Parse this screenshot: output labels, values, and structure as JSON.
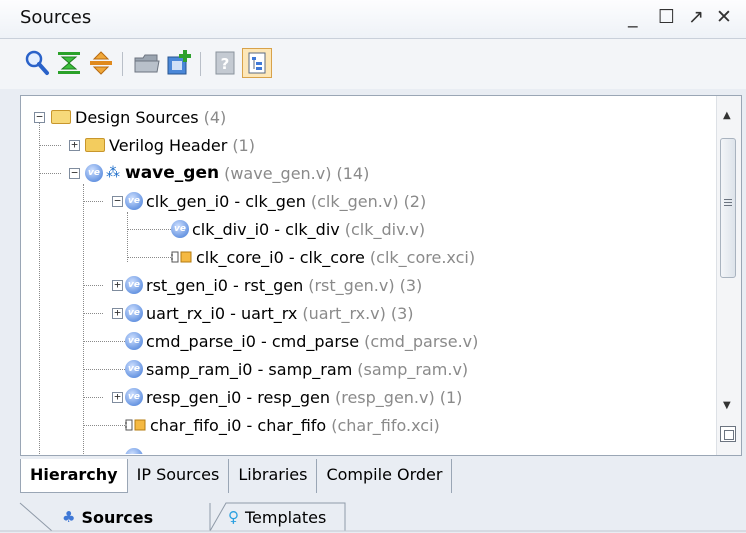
{
  "window": {
    "title": "Sources",
    "minimize": "_",
    "maximize": "☐",
    "float": "↗",
    "close": "✕"
  },
  "toolbar": {
    "buttons": [
      "search-icon",
      "collapse-all-icon",
      "expand-all-icon",
      "open-folder-icon",
      "add-sources-icon",
      "help-icon",
      "show-hierarchy-icon"
    ]
  },
  "tree": {
    "design_sources": {
      "label": "Design Sources",
      "count": "(4)"
    },
    "verilog_header": {
      "label": "Verilog Header",
      "count": "(1)"
    },
    "wave_gen": {
      "label": "wave_gen",
      "file": "(wave_gen.v)",
      "count": "(14)"
    },
    "clk_gen": {
      "label": "clk_gen_i0 - clk_gen",
      "file": "(clk_gen.v)",
      "count": "(2)"
    },
    "clk_div": {
      "label": "clk_div_i0 - clk_div",
      "file": "(clk_div.v)"
    },
    "clk_core": {
      "label": "clk_core_i0 - clk_core",
      "file": "(clk_core.xci)"
    },
    "rst_gen": {
      "label": "rst_gen_i0 - rst_gen",
      "file": "(rst_gen.v)",
      "count": "(3)"
    },
    "uart_rx": {
      "label": "uart_rx_i0 - uart_rx",
      "file": "(uart_rx.v)",
      "count": "(3)"
    },
    "cmd_parse": {
      "label": "cmd_parse_i0 - cmd_parse",
      "file": "(cmd_parse.v)"
    },
    "samp_ram": {
      "label": "samp_ram_i0 - samp_ram",
      "file": "(samp_ram.v)"
    },
    "resp_gen": {
      "label": "resp_gen_i0 - resp_gen",
      "file": "(resp_gen.v)",
      "count": "(1)"
    },
    "char_fifo": {
      "label": "char_fifo_i0 - char_fifo",
      "file": "(char_fifo.xci)"
    }
  },
  "view_tabs": [
    "Hierarchy",
    "IP Sources",
    "Libraries",
    "Compile Order"
  ],
  "bottom_tabs": {
    "sources": "Sources",
    "templates": "Templates"
  },
  "colors": {
    "accent": "#3f78d6",
    "highlight": "#f5a623"
  }
}
